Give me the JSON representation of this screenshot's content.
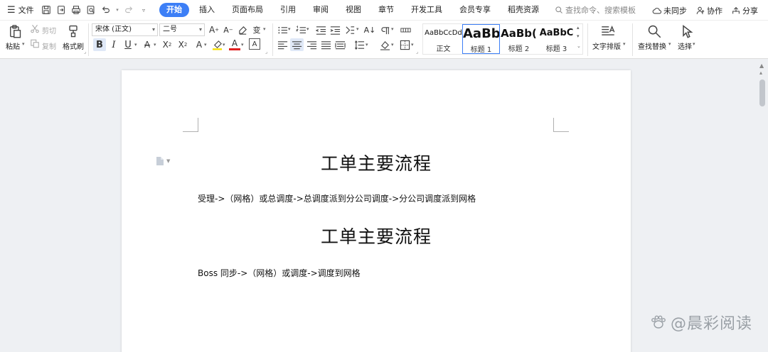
{
  "menubar": {
    "file_label": "文件",
    "tabs": [
      "开始",
      "插入",
      "页面布局",
      "引用",
      "审阅",
      "视图",
      "章节",
      "开发工具",
      "会员专享",
      "稻壳资源"
    ],
    "search_placeholder": "查找命令、搜索模板",
    "sync_label": "未同步",
    "collab_label": "协作",
    "share_label": "分享"
  },
  "ribbon": {
    "paste_label": "粘贴",
    "cut_label": "剪切",
    "copy_label": "复制",
    "format_painter_label": "格式刷",
    "font_name": "宋体 (正文)",
    "font_size": "二号",
    "styles": [
      {
        "preview": "AaBbCcDd",
        "name": "正文"
      },
      {
        "preview": "AaBb",
        "name": "标题 1"
      },
      {
        "preview": "AaBb(",
        "name": "标题 2"
      },
      {
        "preview": "AaBbC",
        "name": "标题 3"
      }
    ],
    "text_layout_label": "文字排版",
    "find_replace_label": "查找替换",
    "select_label": "选择"
  },
  "document": {
    "heading1": "工单主要流程",
    "para1": "受理->（网格）或总调度->总调度派到分公司调度->分公司调度派到网格",
    "heading2": "工单主要流程",
    "para2": "Boss 同步->（网格）或调度->调度到网格"
  },
  "watermark": "@晨彩阅读"
}
